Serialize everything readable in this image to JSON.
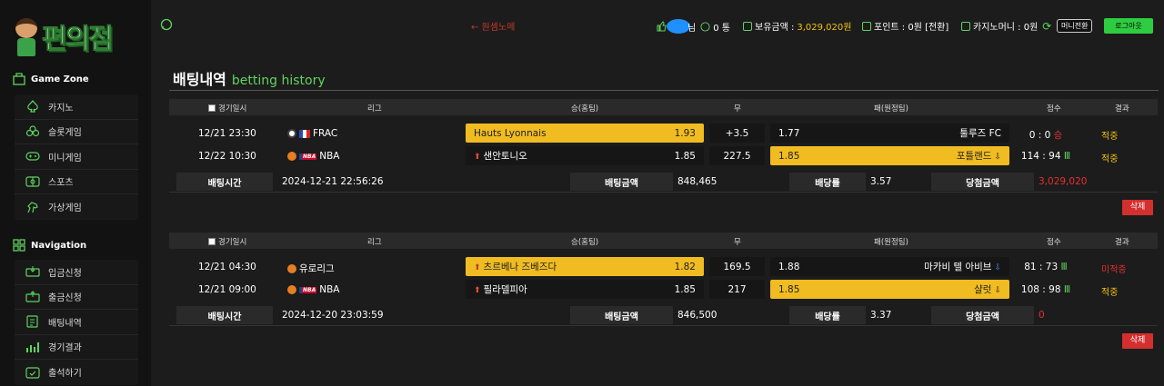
{
  "logo": {
    "text": "편의점"
  },
  "sidebar": {
    "game_zone": {
      "title": "Game Zone",
      "items": [
        {
          "label": "카지노",
          "icon": "spade-icon"
        },
        {
          "label": "슬롯게임",
          "icon": "clover-icon"
        },
        {
          "label": "미니게임",
          "icon": "gamepad-icon"
        },
        {
          "label": "스포츠",
          "icon": "stadium-icon"
        },
        {
          "label": "가상게임",
          "icon": "horse-icon"
        }
      ]
    },
    "navigation": {
      "title": "Navigation",
      "items": [
        {
          "label": "입금신청",
          "icon": "deposit-icon"
        },
        {
          "label": "출금신청",
          "icon": "withdraw-icon"
        },
        {
          "label": "배팅내역",
          "icon": "history-icon"
        },
        {
          "label": "경기결과",
          "icon": "results-icon"
        },
        {
          "label": "출석하기",
          "icon": "attendance-icon"
        }
      ]
    }
  },
  "header": {
    "link": "← 원셈노메",
    "user_suffix": "님",
    "messages": "0 통",
    "balance_label": "보유금액 :",
    "balance_value": "3,029,020원",
    "points": "포인트 : 0원 [전환]",
    "casino_money": "카지노머니 : 0원",
    "mini_btn": "머니전환",
    "logout": "로그아웃"
  },
  "page": {
    "title_ko": "배팅내역",
    "title_en": "betting history"
  },
  "table_headers": {
    "date": "경기일시",
    "league": "리그",
    "home": "승(홈팀)",
    "draw": "무",
    "away": "패(원정팀)",
    "score": "점수",
    "result": "결과"
  },
  "summary_labels": {
    "bet_time": "배팅시간",
    "bet_amount": "배팅금액",
    "odds": "배당률",
    "win_amount": "당첨금액"
  },
  "delete_label": "삭제",
  "colors": {
    "accent_green": "#5fd35f",
    "selected": "#f0bc21",
    "danger": "#d32f2f"
  },
  "bets": [
    {
      "games": [
        {
          "date": "12/21 23:30",
          "league": "FRAC",
          "sport": "soccer",
          "home": "Hauts Lyonnais",
          "home_odds": "1.93",
          "home_selected": true,
          "home_arrow": "",
          "draw": "+3.5",
          "away_odds": "1.77",
          "away": "툴루즈 FC",
          "away_selected": false,
          "away_arrow": "",
          "score": "0 : 0",
          "score_mark": "승",
          "score_mark_color": "red",
          "result": "적중",
          "result_color": "amber"
        },
        {
          "date": "12/22 10:30",
          "league": "NBA",
          "sport": "basketball",
          "home": "샌안토니오",
          "home_odds": "1.85",
          "home_selected": false,
          "home_arrow": "up",
          "draw": "227.5",
          "away_odds": "1.85",
          "away": "포틀랜드",
          "away_selected": true,
          "away_arrow": "down",
          "score": "114 : 94",
          "score_mark": "Ⅲ",
          "score_mark_color": "green",
          "result": "적중",
          "result_color": "amber"
        }
      ],
      "bet_time": "2024-12-21 22:56:26",
      "bet_amount": "848,465",
      "odds": "3.57",
      "win_amount": "3,029,020",
      "win_color": "red"
    },
    {
      "games": [
        {
          "date": "12/21 04:30",
          "league": "유로리그",
          "sport": "basketball",
          "home": "츠르베나 즈베즈다",
          "home_odds": "1.82",
          "home_selected": true,
          "home_arrow": "up",
          "draw": "169.5",
          "away_odds": "1.88",
          "away": "마카비 텔 아비브",
          "away_selected": false,
          "away_arrow": "down",
          "score": "81 : 73",
          "score_mark": "Ⅲ",
          "score_mark_color": "green",
          "result": "미적중",
          "result_color": "red"
        },
        {
          "date": "12/21 09:00",
          "league": "NBA",
          "sport": "basketball",
          "home": "필라델피아",
          "home_odds": "1.85",
          "home_selected": false,
          "home_arrow": "up",
          "draw": "217",
          "away_odds": "1.85",
          "away": "샬럿",
          "away_selected": true,
          "away_arrow": "down",
          "score": "108 : 98",
          "score_mark": "Ⅲ",
          "score_mark_color": "green",
          "result": "적중",
          "result_color": "amber"
        }
      ],
      "bet_time": "2024-12-20 23:03:59",
      "bet_amount": "846,500",
      "odds": "3.37",
      "win_amount": "0",
      "win_color": "red"
    }
  ]
}
